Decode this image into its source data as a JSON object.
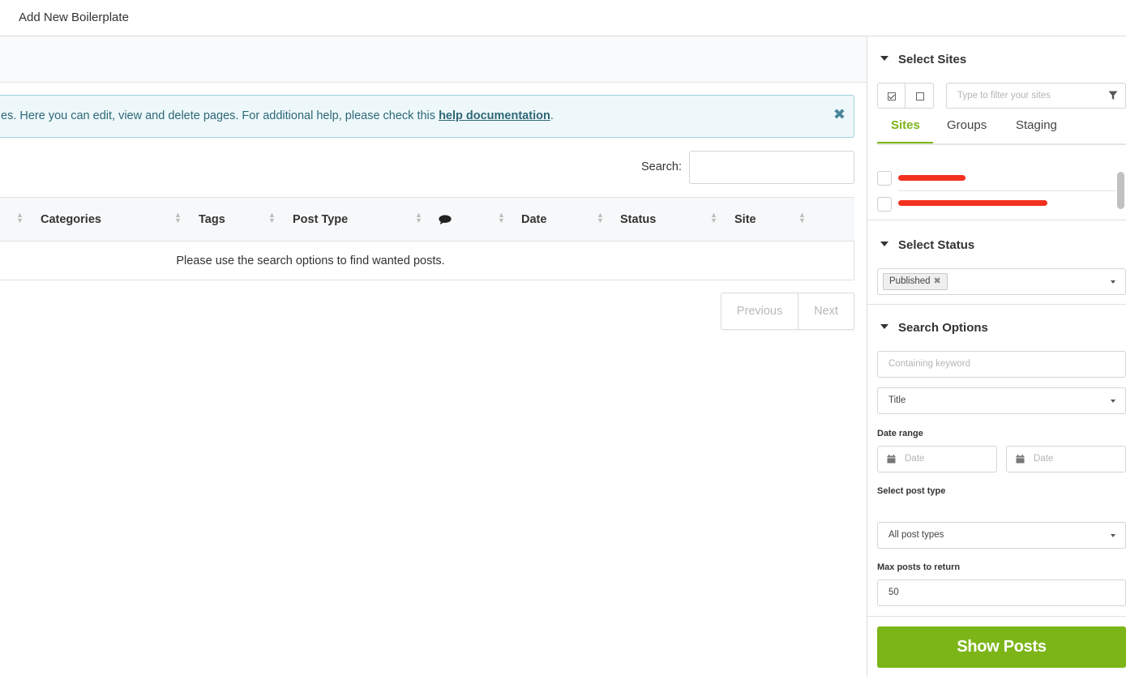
{
  "topbar": {
    "breadcrumb": "Add New Boilerplate"
  },
  "notice": {
    "text_before": "es. Here you can edit, view and delete pages. For additional help, please check this ",
    "link_text": "help documentation",
    "text_after": ".",
    "close_glyph": "✖"
  },
  "search": {
    "label": "Search:",
    "value": ""
  },
  "table": {
    "columns": {
      "categories": "Categories",
      "tags": "Tags",
      "post_type": "Post Type",
      "date": "Date",
      "status": "Status",
      "site": "Site"
    },
    "comment_icon": "comment-icon",
    "empty_message": "Please use the search options to find wanted posts."
  },
  "pagination": {
    "previous": "Previous",
    "next": "Next"
  },
  "sidebar": {
    "select_sites": {
      "title": "Select Sites",
      "filter_placeholder": "Type to filter your sites",
      "tabs": [
        "Sites",
        "Groups",
        "Staging"
      ],
      "active_tab": "Sites"
    },
    "select_status": {
      "title": "Select Status",
      "selected": "Published",
      "remove_glyph": "✖"
    },
    "search_options": {
      "title": "Search Options",
      "keyword_placeholder": "Containing keyword",
      "search_in": "Title",
      "date_range_label": "Date range",
      "date_from_placeholder": "Date",
      "date_to_placeholder": "Date",
      "post_type_label": "Select post type",
      "post_type_value": "All post types",
      "max_posts_label": "Max posts to return",
      "max_posts_value": "50"
    },
    "show_posts_button": "Show Posts"
  },
  "colors": {
    "accent_green": "#7cb518",
    "notice_bg": "#eef8fb",
    "notice_text": "#2e6776",
    "redaction": "#f2311f"
  }
}
